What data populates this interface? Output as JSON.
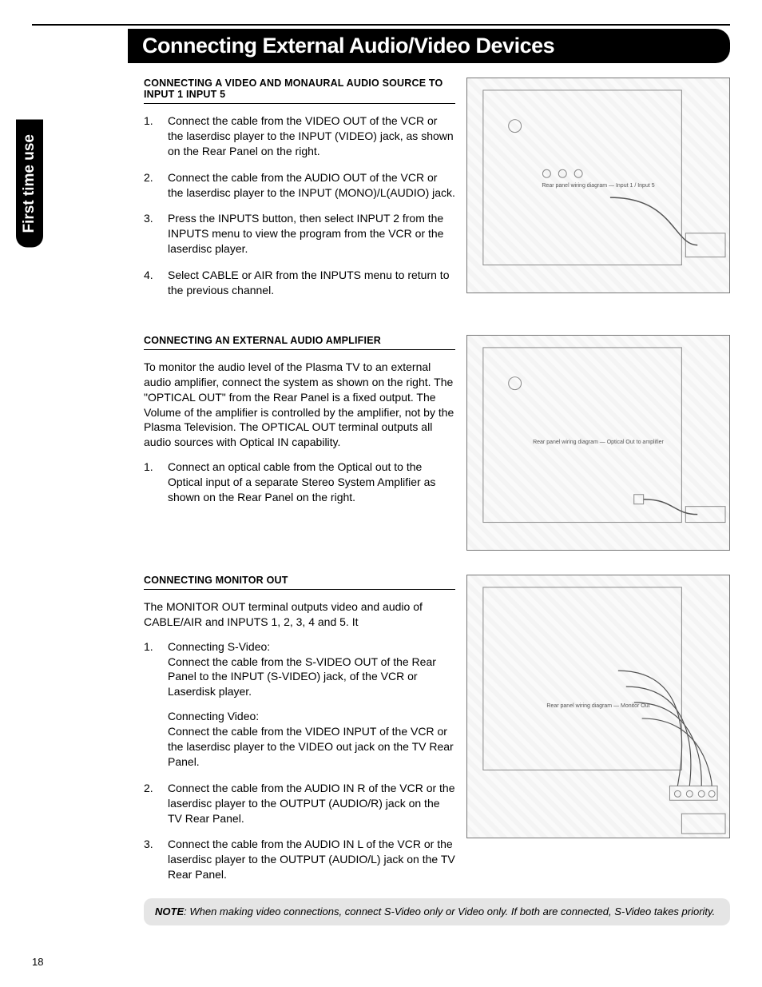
{
  "page_number": "18",
  "side_tab": "First time use",
  "title": "Connecting External Audio/Video Devices",
  "section1": {
    "heading": "CONNECTING A VIDEO AND MONAURAL AUDIO SOURCE TO INPUT 1     INPUT 5",
    "items": [
      "Connect the cable from the VIDEO OUT of the VCR or the laserdisc player to the INPUT (VIDEO) jack, as shown on the Rear Panel on the right.",
      "Connect the cable from the AUDIO OUT of the VCR or the laserdisc player to the INPUT (MONO)/L(AUDIO) jack.",
      "Press the INPUTS button, then select INPUT 2 from the INPUTS menu to view the program from the VCR or the laserdisc player.",
      "Select CABLE or AIR from the INPUTS menu to return to the previous channel."
    ]
  },
  "section2": {
    "heading": "CONNECTING AN EXTERNAL AUDIO AMPLIFIER",
    "intro": "To monitor the audio level of the Plasma TV to an external audio amplifier, connect the system as shown on the right.  The \"OPTICAL OUT\" from the Rear Panel is a fixed output.  The Volume of the amplifier is controlled by the amplifier, not by the Plasma Television.  The OPTICAL OUT terminal outputs all audio sources with Optical IN capability.",
    "items": [
      "Connect an optical cable from the Optical out to the Optical input of a separate Stereo System Amplifier as shown on the Rear Panel on the right."
    ]
  },
  "section3": {
    "heading": "CONNECTING MONITOR OUT",
    "intro": "The MONITOR OUT terminal outputs video and audio of CABLE/AIR and INPUTS 1, 2, 3, 4 and 5.  It",
    "items": [
      {
        "lead": "Connecting S-Video:",
        "body": "Connect the cable from the S-VIDEO OUT of the Rear Panel to the INPUT (S-VIDEO) jack, of the VCR or Laserdisk player.",
        "sub_lead": "Connecting Video:",
        "sub_body": "Connect the cable from the VIDEO INPUT of the VCR or the laserdisc player to the VIDEO out jack on the TV Rear Panel."
      },
      {
        "body": "Connect the cable from the AUDIO IN R of the VCR or the laserdisc player to the OUTPUT (AUDIO/R) jack on the TV Rear Panel."
      },
      {
        "body": "Connect the cable from the AUDIO IN L of the VCR or the laserdisc player to the OUTPUT (AUDIO/L) jack on the TV Rear Panel."
      }
    ]
  },
  "note": {
    "label": "NOTE",
    "text": ":  When making video connections, connect S-Video only or Video only.  If both are connected, S-Video takes priority."
  },
  "diagram_labels": {
    "d1": "Rear panel wiring diagram — Input 1 / Input 5",
    "d2": "Rear panel wiring diagram — Optical Out to amplifier",
    "d3": "Rear panel wiring diagram — Monitor Out"
  }
}
